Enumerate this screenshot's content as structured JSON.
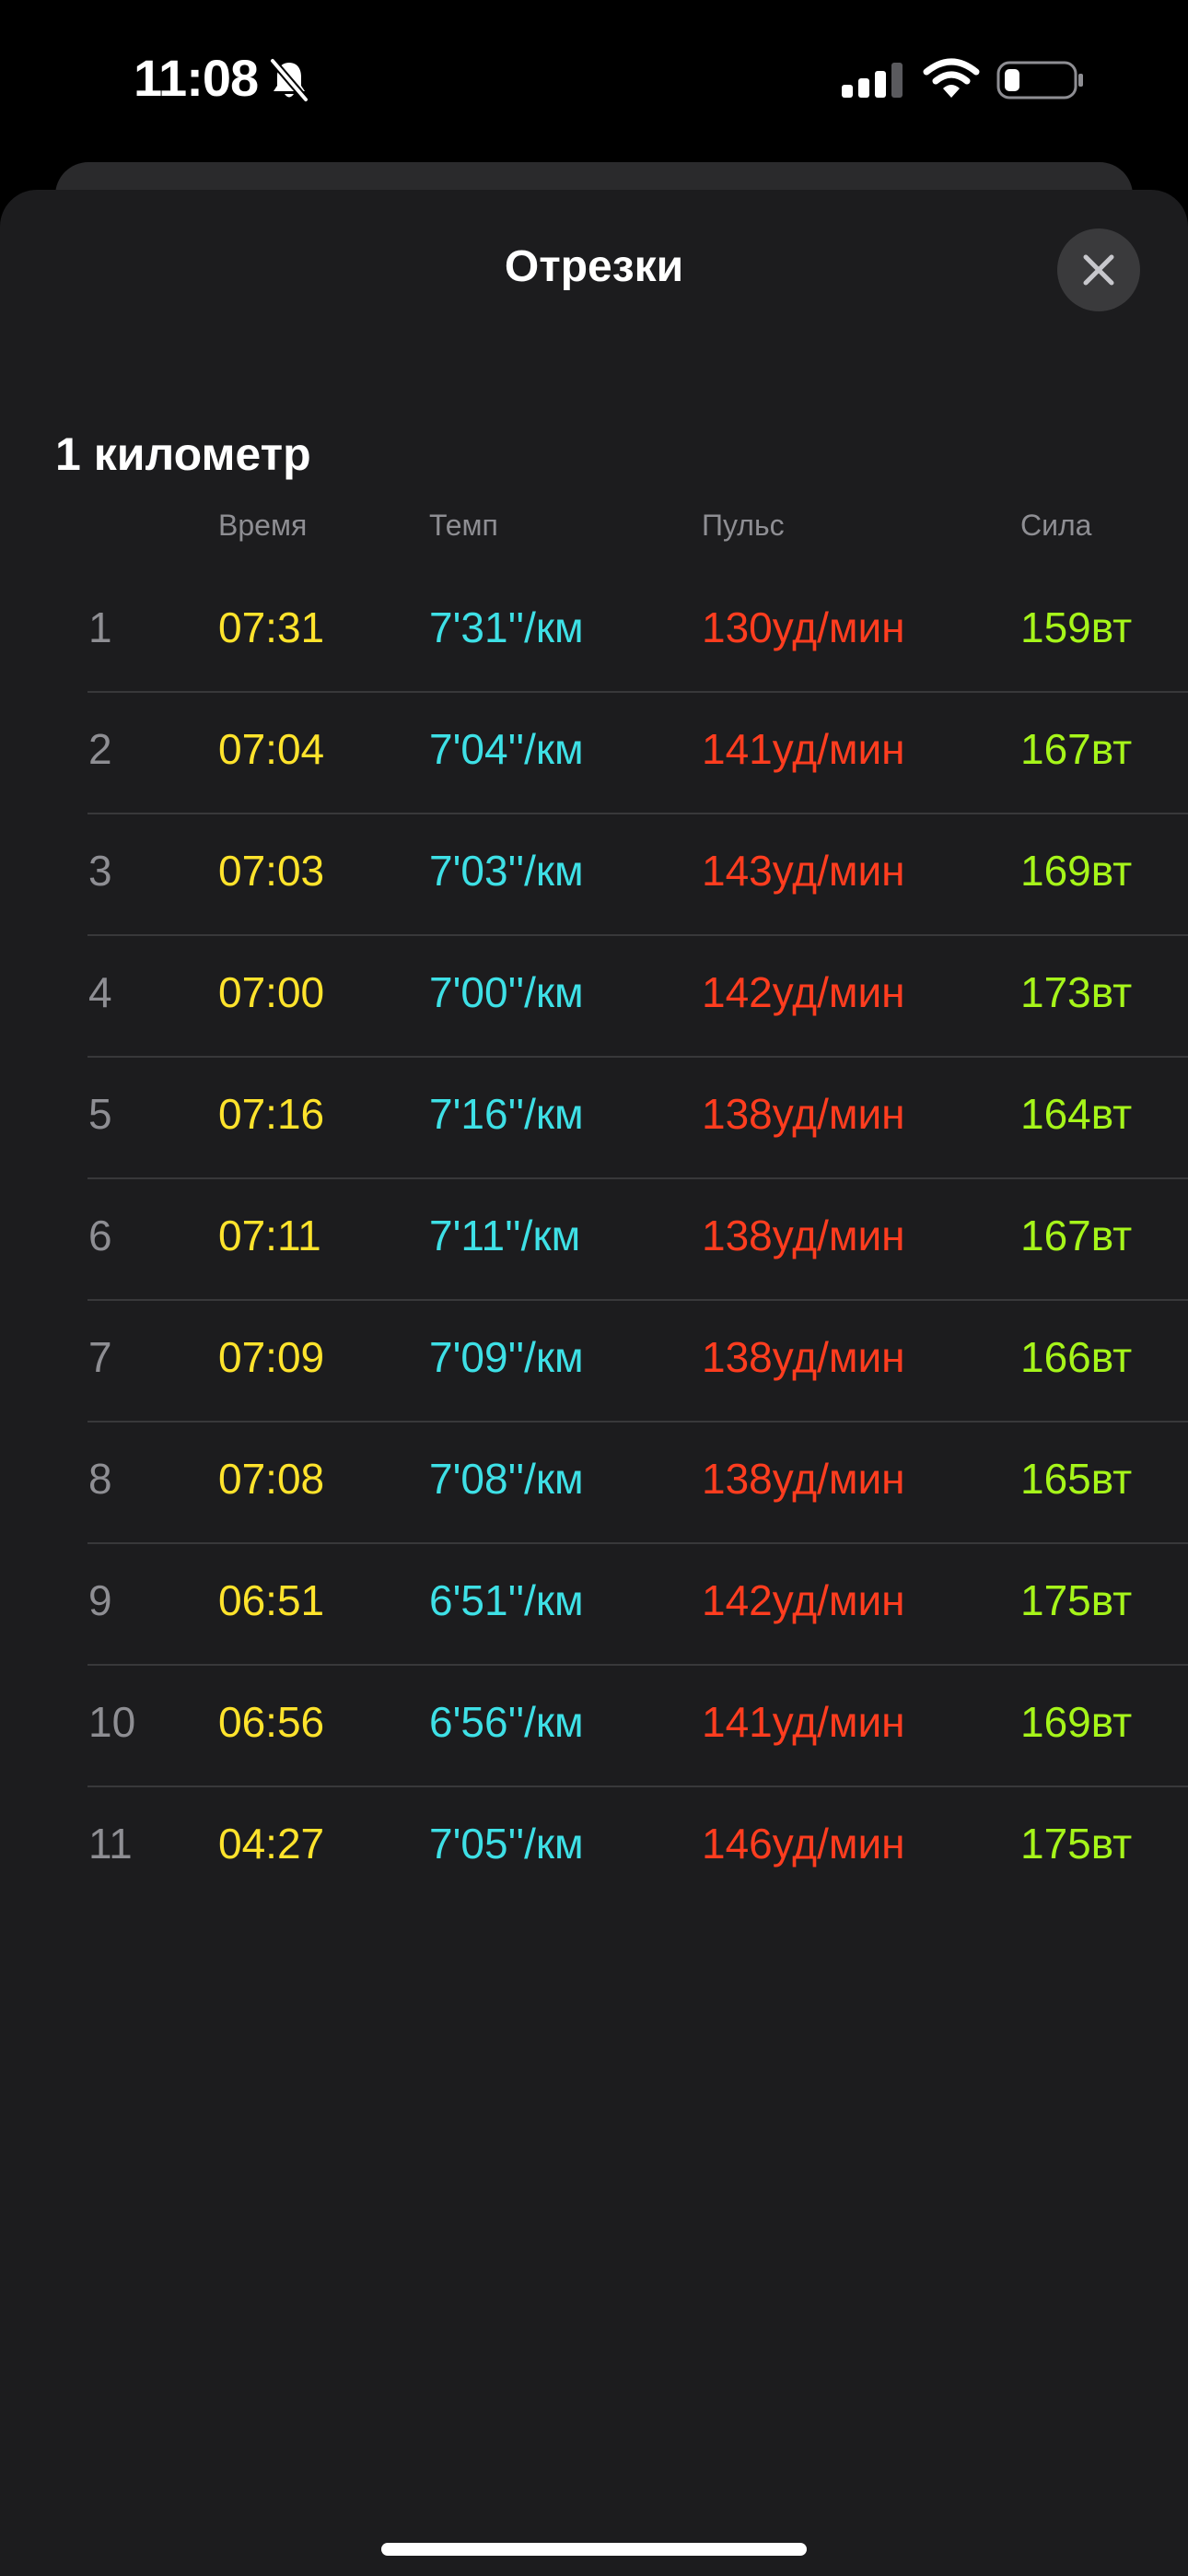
{
  "status_bar": {
    "time": "11:08"
  },
  "sheet": {
    "title": "Отрезки",
    "section_title": "1 километр"
  },
  "columns": {
    "time": "Время",
    "pace": "Темп",
    "heart_rate": "Пульс",
    "power": "Сила"
  },
  "colors": {
    "time": "#ffe32c",
    "pace": "#3ee0e6",
    "heart_rate": "#ff3d1f",
    "power": "#a6f51a"
  },
  "splits": [
    {
      "index": "1",
      "time": "07:31",
      "pace": "7'31''/км",
      "heart_rate": "130уд/мин",
      "power": "159вт"
    },
    {
      "index": "2",
      "time": "07:04",
      "pace": "7'04''/км",
      "heart_rate": "141уд/мин",
      "power": "167вт"
    },
    {
      "index": "3",
      "time": "07:03",
      "pace": "7'03''/км",
      "heart_rate": "143уд/мин",
      "power": "169вт"
    },
    {
      "index": "4",
      "time": "07:00",
      "pace": "7'00''/км",
      "heart_rate": "142уд/мин",
      "power": "173вт"
    },
    {
      "index": "5",
      "time": "07:16",
      "pace": "7'16''/км",
      "heart_rate": "138уд/мин",
      "power": "164вт"
    },
    {
      "index": "6",
      "time": "07:11",
      "pace": "7'11''/км",
      "heart_rate": "138уд/мин",
      "power": "167вт"
    },
    {
      "index": "7",
      "time": "07:09",
      "pace": "7'09''/км",
      "heart_rate": "138уд/мин",
      "power": "166вт"
    },
    {
      "index": "8",
      "time": "07:08",
      "pace": "7'08''/км",
      "heart_rate": "138уд/мин",
      "power": "165вт"
    },
    {
      "index": "9",
      "time": "06:51",
      "pace": "6'51''/км",
      "heart_rate": "142уд/мин",
      "power": "175вт"
    },
    {
      "index": "10",
      "time": "06:56",
      "pace": "6'56''/км",
      "heart_rate": "141уд/мин",
      "power": "169вт"
    },
    {
      "index": "11",
      "time": "04:27",
      "pace": "7'05''/км",
      "heart_rate": "146уд/мин",
      "power": "175вт"
    }
  ]
}
